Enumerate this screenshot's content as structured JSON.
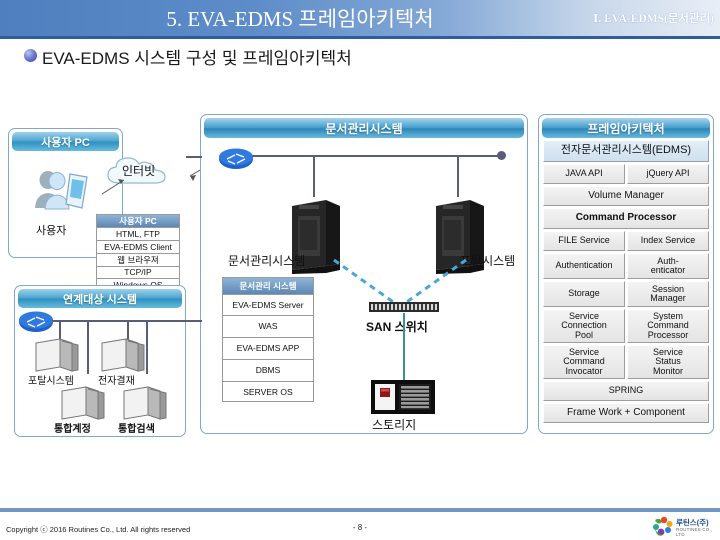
{
  "header": {
    "title": "5. EVA-EDMS 프레임아키텍처",
    "subtitle": "Ⅰ. EVA-EDMS(문서관리)"
  },
  "section": {
    "bullet_icon": "bullet-dot-icon",
    "title": "EVA-EDMS 시스템 구성 및 프레임아키텍처"
  },
  "user_panel": {
    "header": "사용자 PC",
    "user_icon": "user-avatar-icon",
    "user_label": "사용자",
    "cloud_icon": "internet-cloud-icon",
    "cloud_label": "인터빗",
    "stack": {
      "header": "사용자 PC",
      "rows": [
        "HTML, FTP",
        "EVA-EDMS Client",
        "웹 브라우져",
        "TCP/IP",
        "Windows OS"
      ]
    }
  },
  "linked_panel": {
    "header": "연계대상 시스템",
    "router_icon": "network-router-icon",
    "nodes": [
      {
        "label": "포탈시스템",
        "icon": "server-icon"
      },
      {
        "label": "전자결재",
        "icon": "server-icon"
      },
      {
        "label": "통합계정",
        "icon": "server-icon"
      },
      {
        "label": "통합검색",
        "icon": "server-icon"
      }
    ]
  },
  "dms_panel": {
    "header": "문서관리시스템",
    "router_icon": "network-router-icon",
    "servers": [
      {
        "label": "문서관리시스템",
        "icon": "server-tower-icon"
      },
      {
        "label": "포탈시스템",
        "icon": "server-tower-icon"
      }
    ],
    "stack": {
      "header": "문서관리 시스템",
      "rows": [
        "EVA-EDMS Server",
        "WAS",
        "EVA-EDMS APP",
        "DBMS",
        "SERVER OS"
      ]
    },
    "san_switch": {
      "icon": "san-switch-icon",
      "label": "SAN 스위치"
    },
    "storage": {
      "icon": "storage-array-icon",
      "label": "스토리지"
    }
  },
  "framework_panel": {
    "header": "프레임아키텍처",
    "top_block": "전자문서관리시스템(EDMS)",
    "rows": [
      {
        "cells": [
          {
            "text": "JAVA API"
          },
          {
            "text": "jQuery API"
          }
        ]
      },
      {
        "cells": [
          {
            "text": "Volume Manager",
            "span": 2
          }
        ]
      },
      {
        "cells": [
          {
            "text": "Command Processor",
            "span": 2,
            "strong": true
          }
        ]
      },
      {
        "cells": [
          {
            "text": "FILE Service"
          },
          {
            "text": "Index Service"
          }
        ]
      },
      {
        "cells": [
          {
            "text": "Authentication"
          },
          {
            "text": "Auth-\nenticator"
          }
        ]
      },
      {
        "cells": [
          {
            "text": "Storage"
          },
          {
            "text": "Session\nManager"
          }
        ]
      },
      {
        "cells": [
          {
            "text": "Service\nConnection\nPool"
          },
          {
            "text": "System\nCommand\nProcessor"
          }
        ]
      },
      {
        "cells": [
          {
            "text": "Service\nCommand\nInvocator"
          },
          {
            "text": "Service\nStatus\nMonitor"
          }
        ]
      },
      {
        "cells": [
          {
            "text": "SPRING",
            "span": 2
          }
        ]
      },
      {
        "cells": [
          {
            "text": "Frame Work + Component",
            "span": 2
          }
        ]
      }
    ]
  },
  "footer": {
    "copyright": "Copyright ⓒ 2016 Routines Co., Ltd. All rights reserved",
    "page": "- 8 -",
    "logo_icon": "company-logo-icon",
    "logo_text": "루틴스(주)",
    "logo_sub": "ROUTINES CO., LTD"
  },
  "colors": {
    "header_blue": "#4f7fbe",
    "panel_border": "#7fa8cf",
    "panel_head": "#2e8fc0",
    "stack_head": "#5d87b5",
    "line": "#5b5b7a",
    "dash": "#49a7d8"
  }
}
